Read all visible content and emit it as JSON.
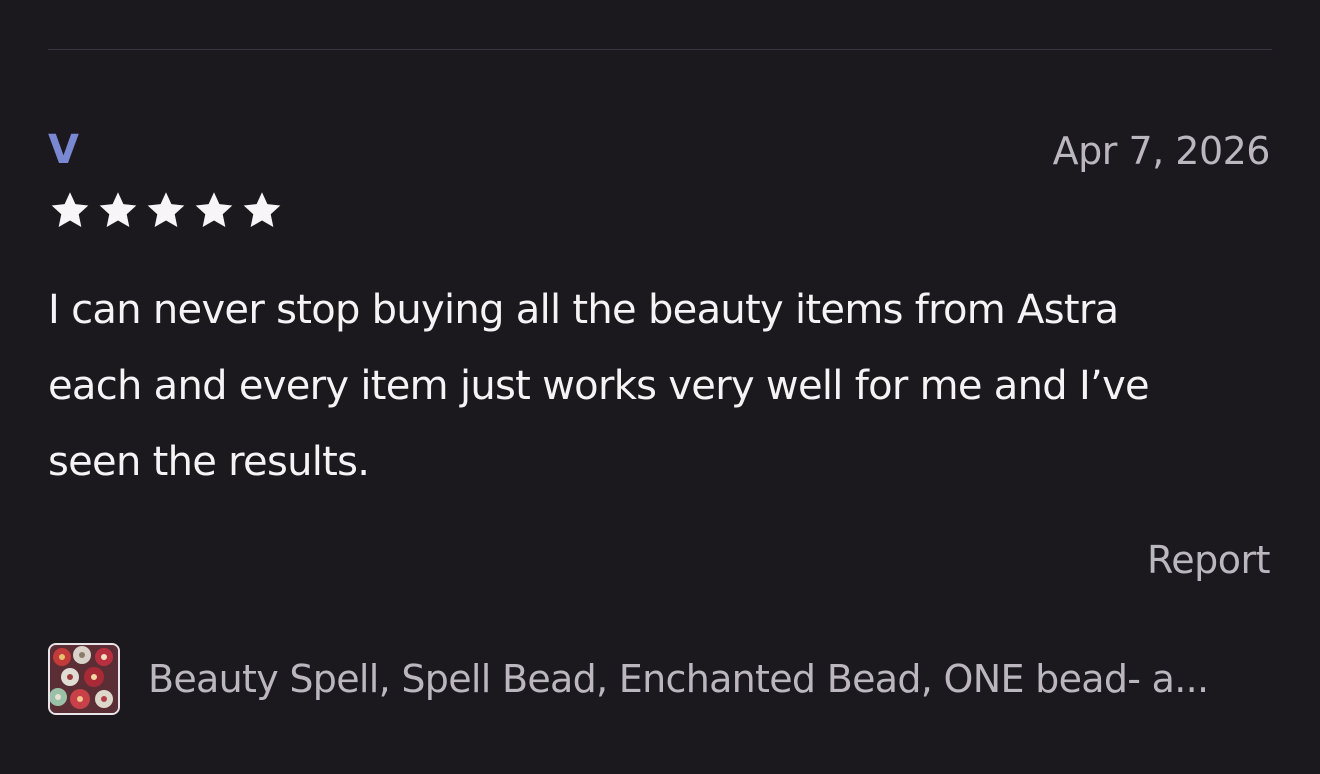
{
  "review": {
    "reviewer": "V",
    "date": "Apr 7, 2026",
    "rating": 5,
    "rating_max": 5,
    "text_lines": [
      "I can never stop buying all the beauty items from Astra",
      "each and every item just works very well for me and I’ve",
      "seen the results."
    ],
    "report_label": "Report",
    "product_title": "Beauty Spell, Spell Bead, Enchanted Bead, ONE bead- a..."
  },
  "colors": {
    "background": "#1c191e",
    "reviewer": "#7a88d4",
    "text": "#f5f3f5",
    "muted": "#bcb6bf",
    "divider": "#3d3545"
  },
  "icons": {
    "star": "star-icon",
    "thumbnail": "product-thumbnail"
  }
}
